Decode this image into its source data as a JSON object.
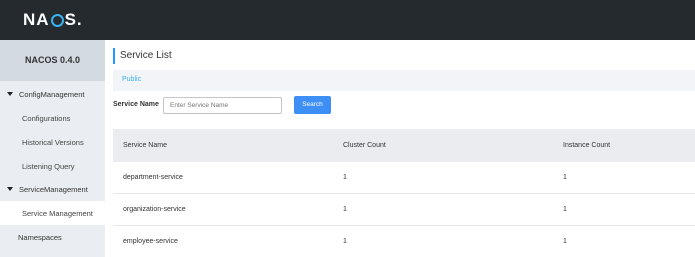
{
  "app": {
    "logo_prefix": "NA",
    "logo_suffix": "S",
    "logo_dot": "."
  },
  "sidebar": {
    "title": "NACOS 0.4.0",
    "items": [
      {
        "label": "ConfigManagement",
        "type": "group",
        "expanded": true
      },
      {
        "label": "Configurations",
        "type": "sub"
      },
      {
        "label": "Historical Versions",
        "type": "sub"
      },
      {
        "label": "Listening Query",
        "type": "sub"
      },
      {
        "label": "ServiceManagement",
        "type": "group",
        "expanded": true
      },
      {
        "label": "Service Management",
        "type": "sub",
        "active": true
      },
      {
        "label": "Namespaces",
        "type": "top"
      }
    ]
  },
  "main": {
    "title": "Service List",
    "namespace": "Public",
    "search": {
      "label": "Service Name",
      "placeholder": "Enter Service Name",
      "value": "",
      "button": "Search"
    },
    "table": {
      "columns": [
        "Service Name",
        "Cluster Count",
        "Instance Count"
      ],
      "rows": [
        [
          "department-service",
          "1",
          "1"
        ],
        [
          "organization-service",
          "1",
          "1"
        ],
        [
          "employee-service",
          "1",
          "1"
        ]
      ]
    }
  },
  "colors": {
    "topbar": "#252a2f",
    "accent": "#209bfa",
    "button": "#3e8ff5",
    "link": "#39b3f0"
  }
}
